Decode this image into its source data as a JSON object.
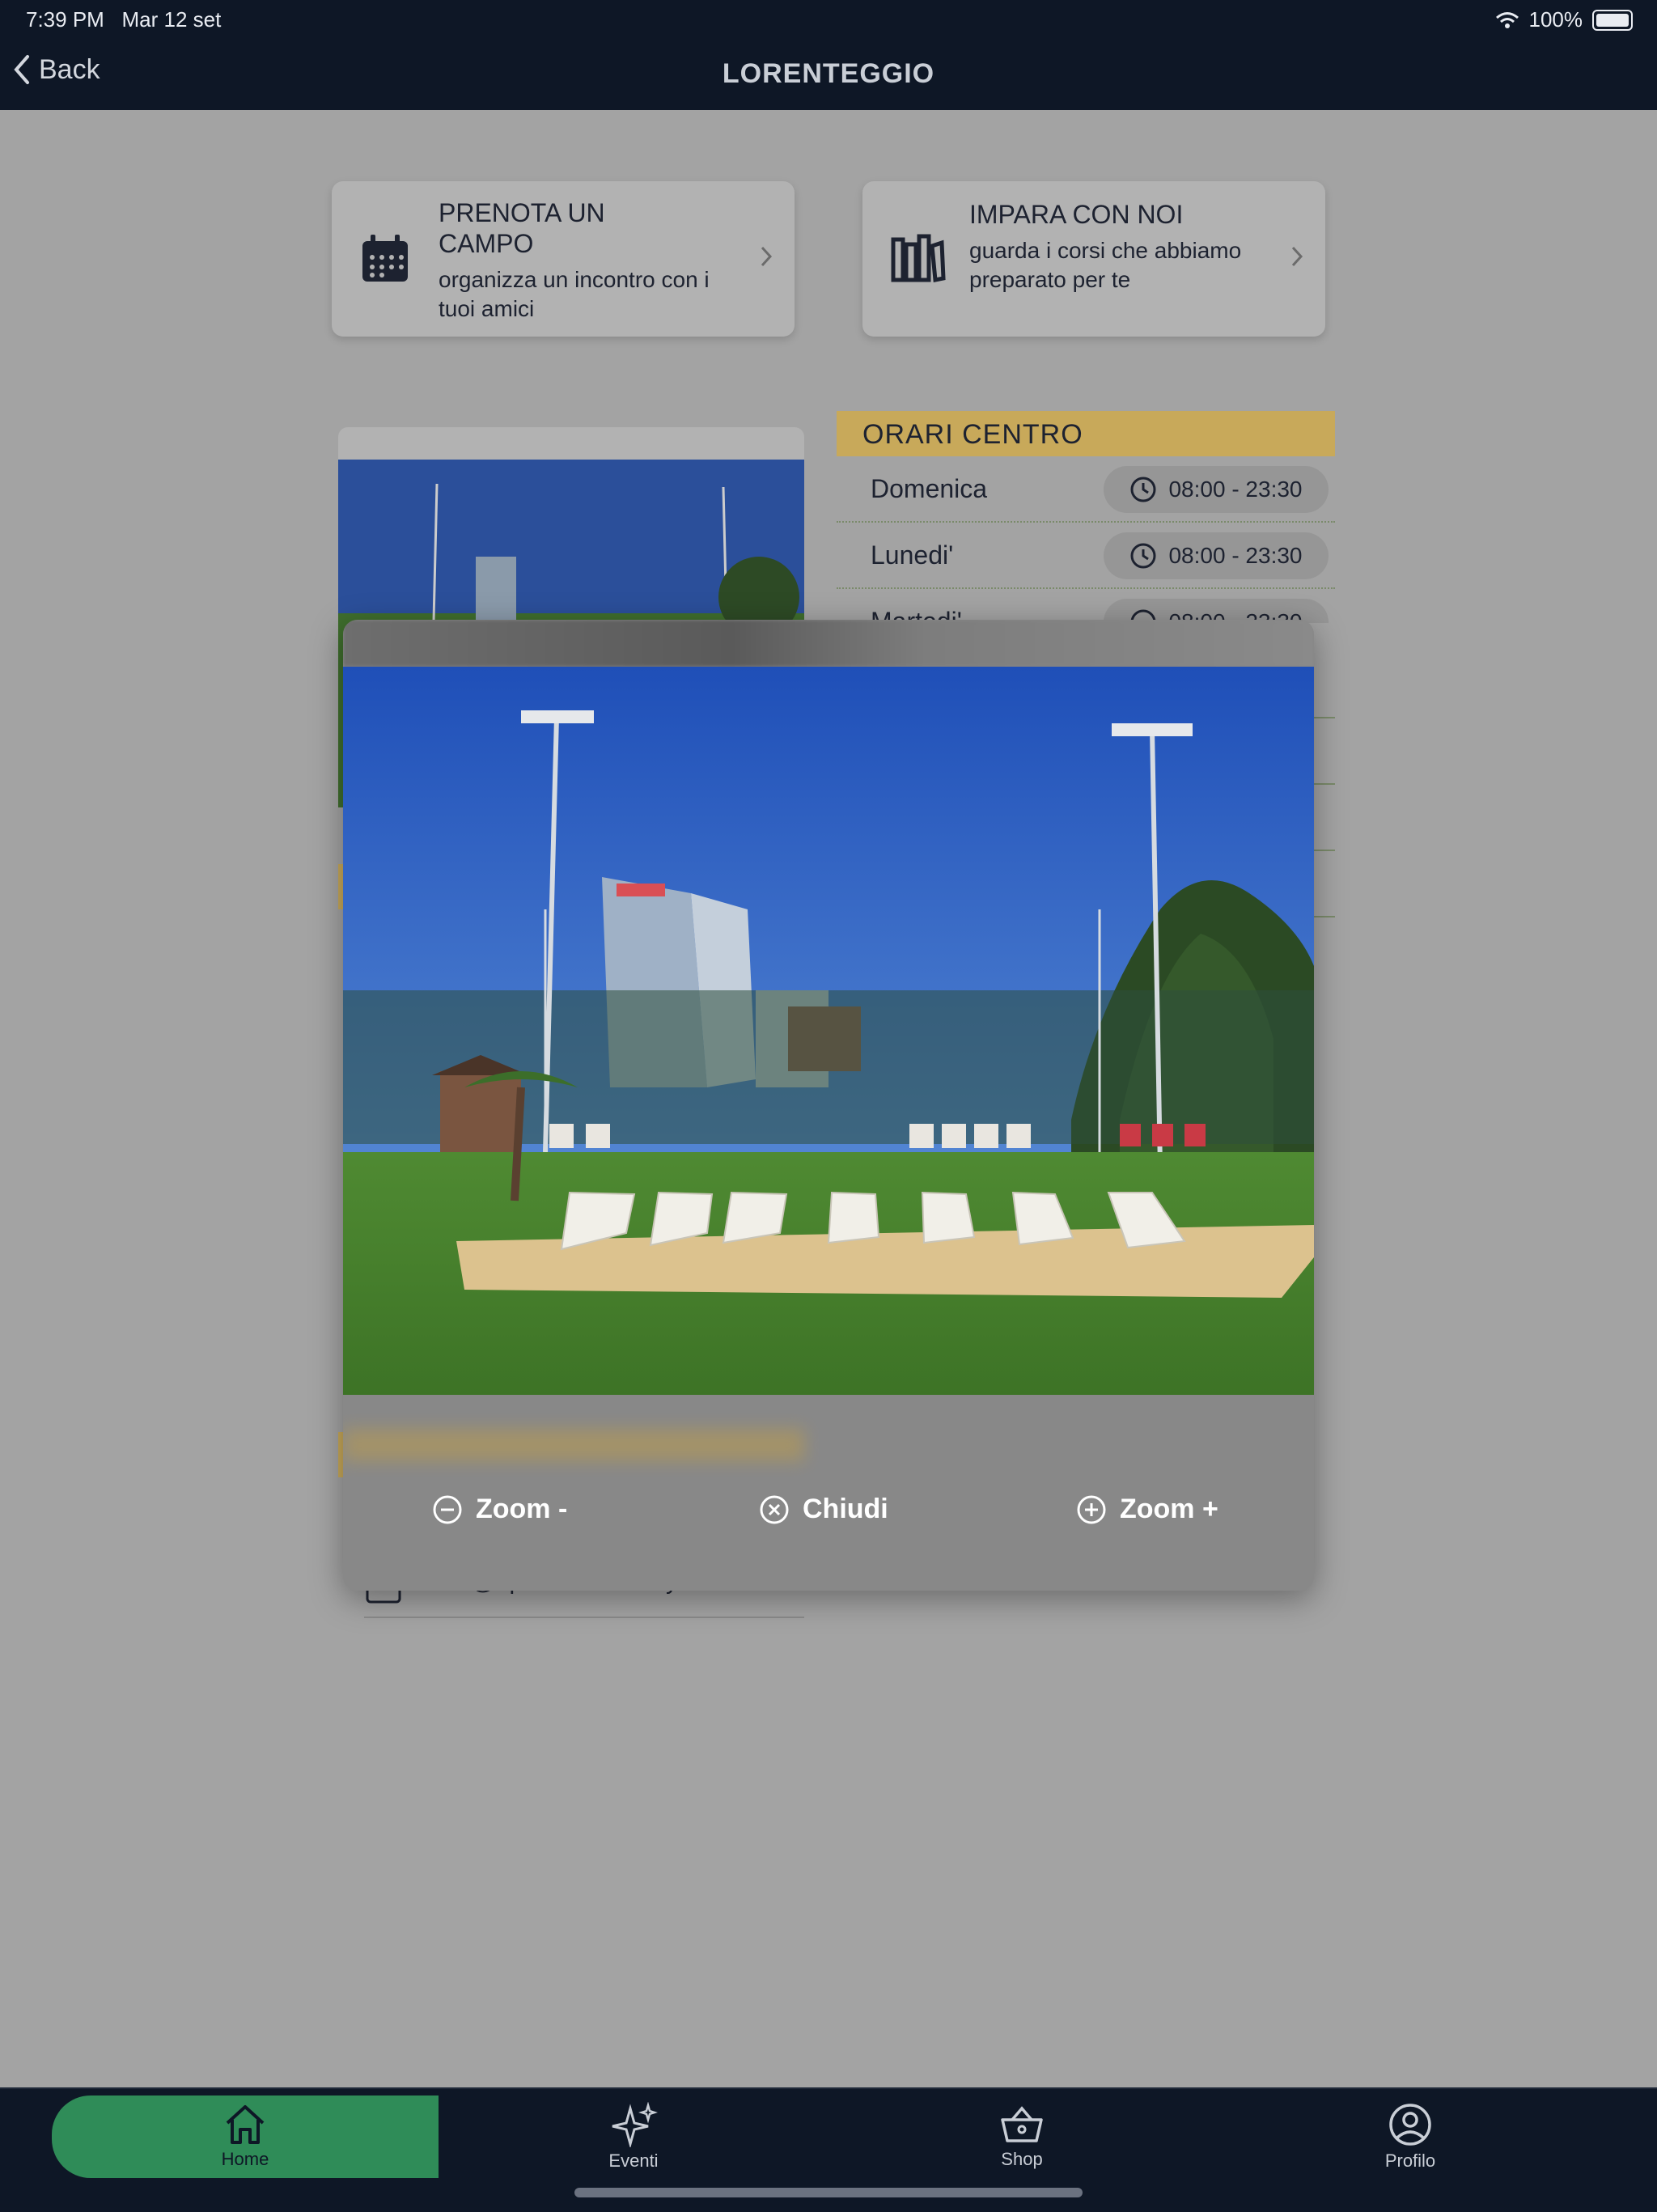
{
  "status_bar": {
    "time": "7:39 PM",
    "date": "Mar 12 set",
    "battery": "100%"
  },
  "nav": {
    "back_label": "Back",
    "title": "LORENTEGGIO"
  },
  "cards": [
    {
      "title": "PRENOTA UN CAMPO",
      "subtitle": "organizza un incontro con i tuoi amici",
      "icon": "calendar-icon"
    },
    {
      "title": "IMPARA CON NOI",
      "subtitle": "guarda i corsi che abbiamo preparato per te",
      "icon": "books-icon"
    }
  ],
  "hours": {
    "title": "ORARI CENTRO",
    "rows": [
      {
        "day": "Domenica",
        "time": "08:00 - 23:30"
      },
      {
        "day": "Lunedi'",
        "time": "08:00 - 23:30"
      },
      {
        "day": "Martedi'",
        "time": "08:00 - 23:30"
      }
    ]
  },
  "contact": {
    "email": "info@openbeachvolley.it"
  },
  "modal": {
    "zoom_out_label": "Zoom -",
    "close_label": "Chiudi",
    "zoom_in_label": "Zoom +"
  },
  "tabs": [
    {
      "label": "Home",
      "icon": "home-icon",
      "active": true
    },
    {
      "label": "Eventi",
      "icon": "sparkles-icon",
      "active": false
    },
    {
      "label": "Shop",
      "icon": "basket-icon",
      "active": false
    },
    {
      "label": "Profilo",
      "icon": "user-circle-icon",
      "active": false
    }
  ],
  "colors": {
    "nav_bg": "#0e1726",
    "gold": "#c8a95a",
    "active_tab": "#2f8c58"
  }
}
